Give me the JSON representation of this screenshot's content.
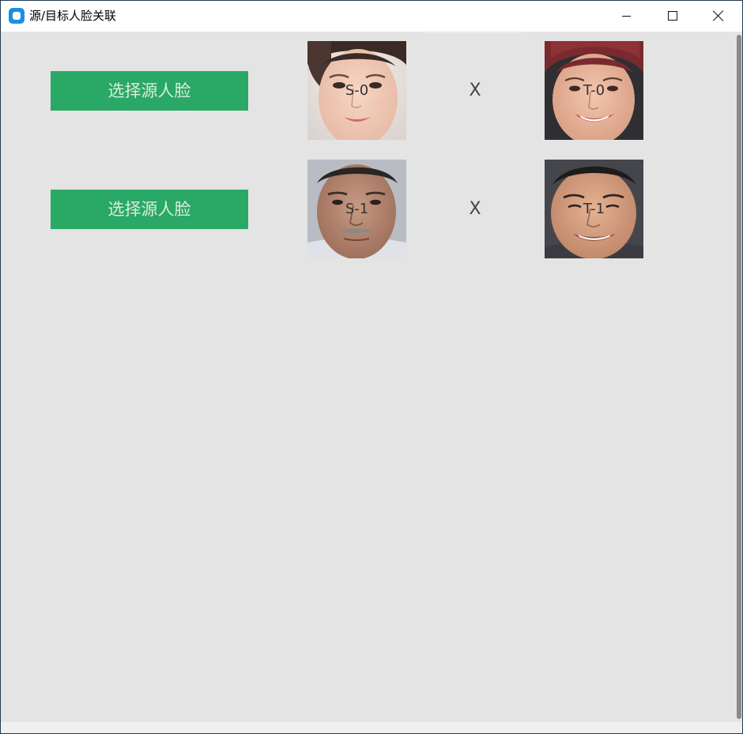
{
  "window": {
    "title": "源/目标人脸关联"
  },
  "rows": [
    {
      "button_label": "选择源人脸",
      "source_label": "S-0",
      "separator": "X",
      "target_label": "T-0"
    },
    {
      "button_label": "选择源人脸",
      "source_label": "S-1",
      "separator": "X",
      "target_label": "T-1"
    }
  ],
  "colors": {
    "button_bg": "#2aa866",
    "button_text": "#d8eed9",
    "content_bg": "#e4e4e4",
    "titlebar_bg": "#ffffff",
    "app_icon": "#1a8fe0"
  },
  "icons": {
    "app": "app-icon",
    "minimize": "minimize-icon",
    "maximize": "maximize-icon",
    "close": "close-icon"
  }
}
